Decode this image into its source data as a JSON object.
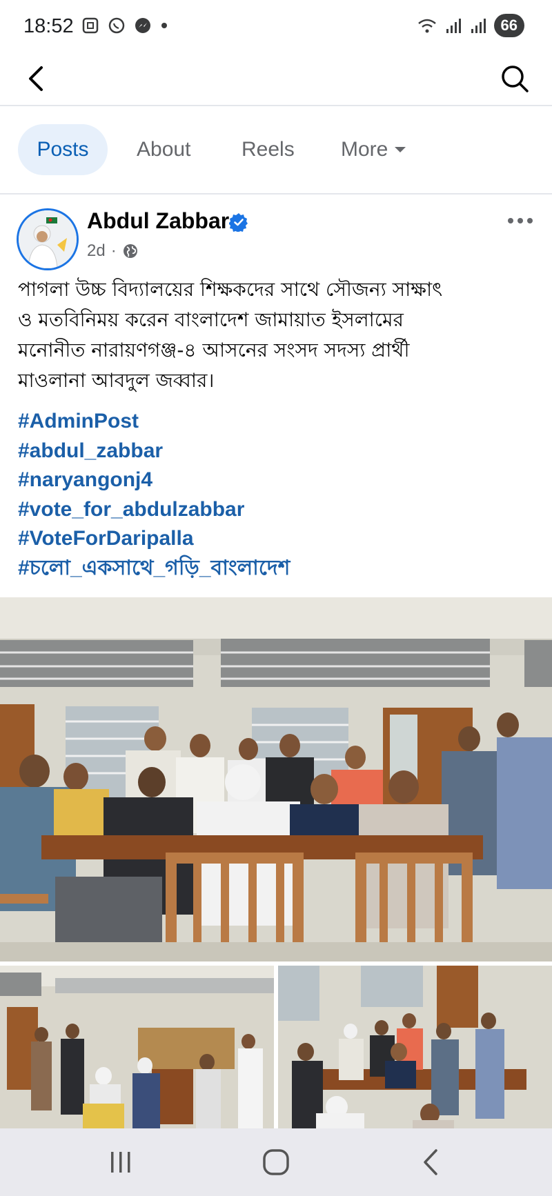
{
  "status_bar": {
    "time": "18:52",
    "battery": "66",
    "icons_left": [
      "screenshot-icon",
      "whatsapp-icon",
      "messenger-icon",
      "dot-icon"
    ],
    "icons_right": [
      "wifi-icon",
      "signal-icon",
      "signal-icon"
    ]
  },
  "top_nav": {
    "back_icon": "chevron-left-icon",
    "search_icon": "search-icon"
  },
  "tabs": [
    {
      "label": "Posts",
      "active": true
    },
    {
      "label": "About",
      "active": false
    },
    {
      "label": "Reels",
      "active": false
    },
    {
      "label": "More",
      "active": false
    }
  ],
  "post": {
    "author": "Abdul Zabbar",
    "time": "2d",
    "separator": "·",
    "privacy_icon": "globe-icon",
    "lines": [
      "পাগলা উচ্চ বিদ্যালয়ের শিক্ষকদের সাথে সৌজন্য সাক্ষাৎ",
      "ও মতবিনিময় করেন বাংলাদেশ জামায়াত ইসলামের",
      "মনোনীত নারায়ণগঞ্জ-৪ আসনের সংসদ সদস্য প্রার্থী",
      "মাওলানা আবদুল জব্বার।"
    ],
    "hashtags": [
      "#AdminPost",
      "#abdul_zabbar",
      "#naryangonj4",
      "#vote_for_abdulzabbar",
      "#VoteForDaripalla",
      "#চলো_একসাথে_গড়ি_বাংলাদেশ"
    ]
  },
  "colors": {
    "accent": "#0a5fb4",
    "active_tab_bg": "#e7f0fb",
    "hashtag": "#1b5fa8",
    "muted": "#65676b",
    "verified": "#1b74e4"
  },
  "system_nav": [
    "recents-icon",
    "home-icon",
    "back-icon"
  ]
}
